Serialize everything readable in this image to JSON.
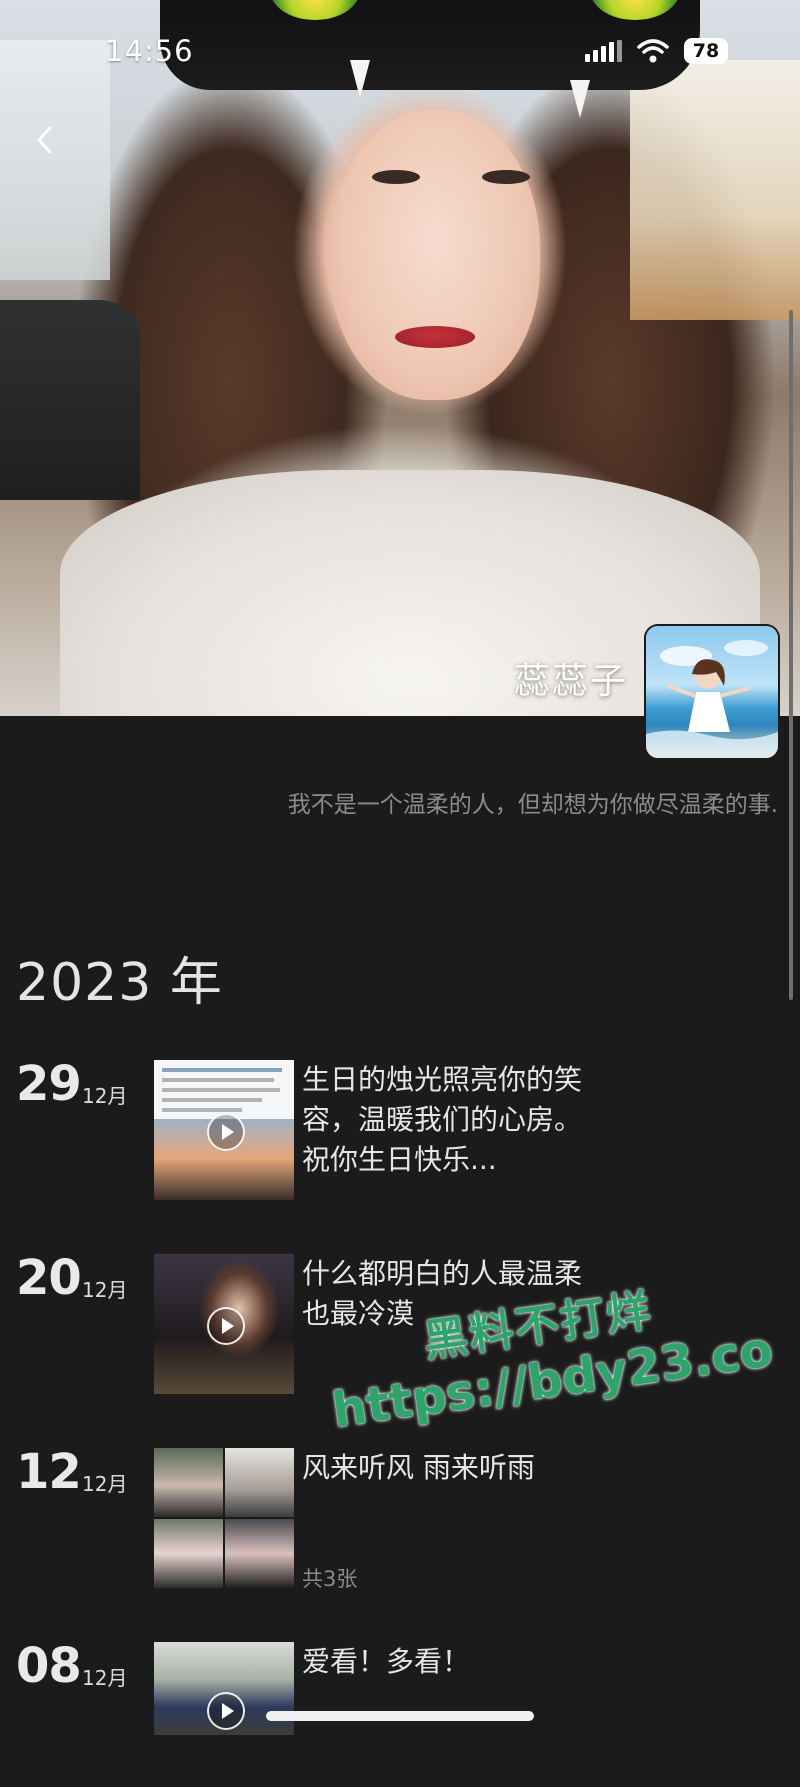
{
  "status_bar": {
    "time": "14:56",
    "battery": "78"
  },
  "profile": {
    "username": "蕊蕊子",
    "signature": "我不是一个温柔的人，但却想为你做尽温柔的事."
  },
  "timeline": {
    "year": "2023 年",
    "entries": [
      {
        "day": "29",
        "month": "12月",
        "text": "生日的烛光照亮你的笑容，温暖我们的心房。祝你生日快乐...",
        "media": "video",
        "count": ""
      },
      {
        "day": "20",
        "month": "12月",
        "text": "什么都明白的人最温柔 也最冷漠",
        "media": "video",
        "count": ""
      },
      {
        "day": "12",
        "month": "12月",
        "text": "风来听风 雨来听雨",
        "media": "album",
        "count": "共3张"
      },
      {
        "day": "08",
        "month": "12月",
        "text": "爱看！多看！",
        "media": "video",
        "count": ""
      }
    ]
  },
  "watermark": {
    "line1": "黑料不打烊",
    "line2": "https://bdy23.co"
  },
  "icons": {
    "back": "chevron-left-icon",
    "signal": "cellular-signal-icon",
    "wifi": "wifi-icon",
    "battery": "battery-icon",
    "play": "play-icon"
  }
}
